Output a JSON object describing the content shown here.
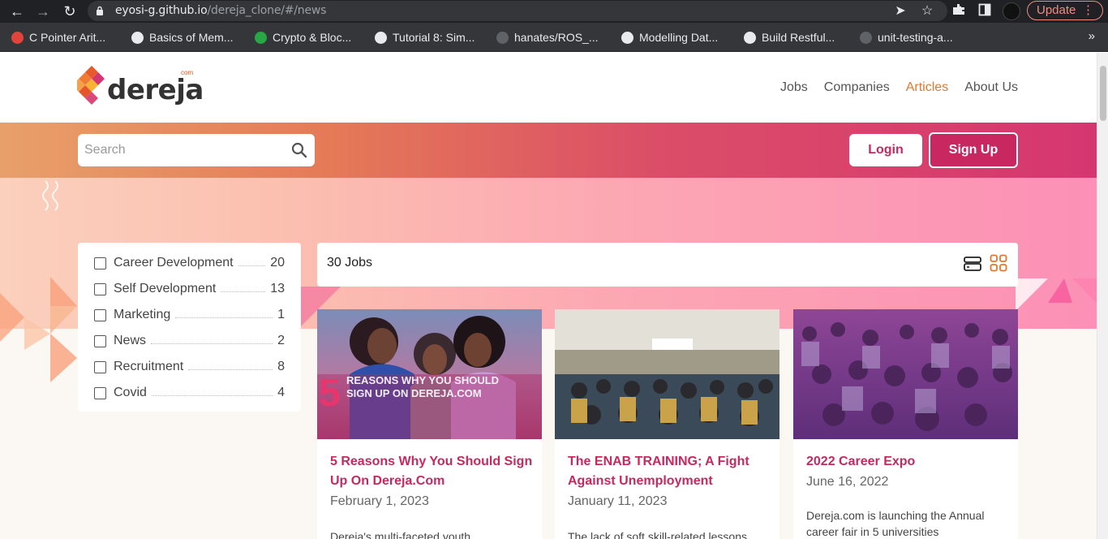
{
  "browser": {
    "url_host": "eyosi-g.github.io",
    "url_path": "/dereja_clone/#/news",
    "update_label": "Update",
    "bookmarks": [
      {
        "label": "C Pointer Arit...",
        "color": "#e0443b"
      },
      {
        "label": "Basics of Mem...",
        "color": "#e8eaed"
      },
      {
        "label": "Crypto & Bloc...",
        "color": "#27a844"
      },
      {
        "label": "Tutorial 8: Sim...",
        "color": "#e8eaed"
      },
      {
        "label": "hanates/ROS_...",
        "color": "#5f6368"
      },
      {
        "label": "Modelling Dat...",
        "color": "#e8eaed"
      },
      {
        "label": "Build Restful...",
        "color": "#e8eaed"
      },
      {
        "label": "unit-testing-a...",
        "color": "#5f6368"
      }
    ]
  },
  "site": {
    "logo_text": "dereja",
    "logo_com": "com",
    "nav": [
      {
        "label": "Jobs",
        "active": false
      },
      {
        "label": "Companies",
        "active": false
      },
      {
        "label": "Articles",
        "active": true
      },
      {
        "label": "About Us",
        "active": false
      }
    ],
    "search_placeholder": "Search",
    "login_label": "Login",
    "signup_label": "Sign Up",
    "accent_color": "#c8285f",
    "active_nav_color": "#e3782b"
  },
  "filters": [
    {
      "label": "Career Development",
      "count": "20"
    },
    {
      "label": "Self Development",
      "count": "13"
    },
    {
      "label": "Marketing",
      "count": "1"
    },
    {
      "label": "News",
      "count": "2"
    },
    {
      "label": "Recruitment",
      "count": "8"
    },
    {
      "label": "Covid",
      "count": "4"
    }
  ],
  "jobs_count": "30 Jobs",
  "cards": [
    {
      "image_caption_number": "5",
      "image_caption": "REASONS WHY YOU SHOULD SIGN UP ON DEREJA.COM",
      "title": "5 Reasons Why You Should Sign Up On Dereja.Com",
      "date": "February 1, 2023",
      "excerpt": "Dereja's multi-faceted youth"
    },
    {
      "title": "The ENAB TRAINING; A Fight Against Unemployment",
      "date": "January 11, 2023",
      "excerpt": "The lack of soft skill-related lessons"
    },
    {
      "title": "2022 Career Expo",
      "date": "June 16, 2022",
      "excerpt": "Dereja.com is launching the Annual career fair in 5 universities"
    }
  ]
}
